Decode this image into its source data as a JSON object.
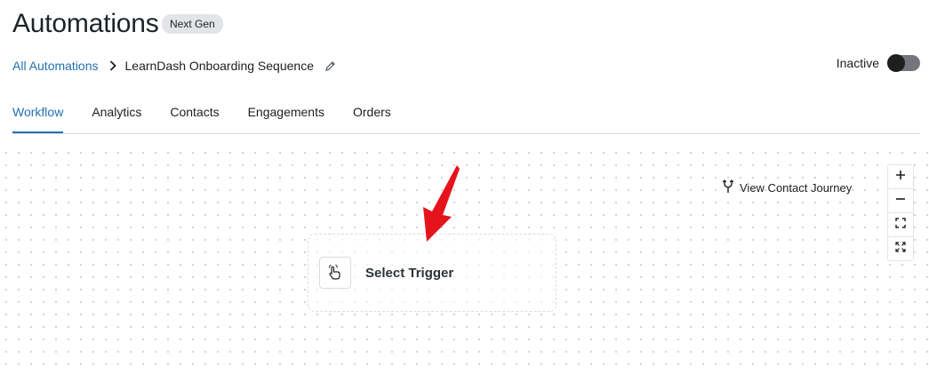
{
  "header": {
    "title": "Automations",
    "badge": "Next Gen"
  },
  "breadcrumb": {
    "root": "All Automations",
    "current": "LearnDash Onboarding Sequence"
  },
  "status": {
    "label": "Inactive",
    "enabled": false
  },
  "tabs": [
    {
      "label": "Workflow",
      "active": true
    },
    {
      "label": "Analytics",
      "active": false
    },
    {
      "label": "Contacts",
      "active": false
    },
    {
      "label": "Engagements",
      "active": false
    },
    {
      "label": "Orders",
      "active": false
    }
  ],
  "canvas": {
    "view_journey": "View Contact Journey",
    "trigger_label": "Select Trigger",
    "zoom_controls": [
      "zoom-in-icon",
      "zoom-out-icon",
      "fit-view-icon",
      "fullscreen-icon"
    ]
  },
  "colors": {
    "accent": "#2271b1",
    "arrow": "#e5141c",
    "badge_bg": "#e2e4e7"
  }
}
